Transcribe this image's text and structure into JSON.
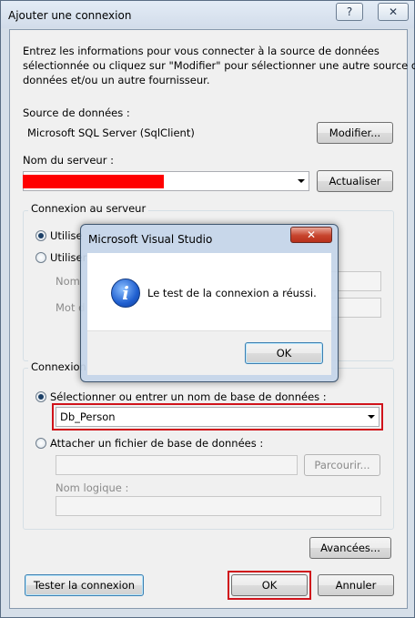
{
  "window": {
    "title": "Ajouter une connexion",
    "help_glyph": "?",
    "close_glyph": "✕"
  },
  "intro_text_lines": [
    "Entrez les informations pour vous connecter à la source de données",
    "sélectionnée ou cliquez sur \"Modifier\" pour sélectionner une autre source de",
    "données et/ou un autre fournisseur."
  ],
  "data_source": {
    "label": "Source de données :",
    "value": "Microsoft SQL Server (SqlClient)",
    "modify_button": "Modifier..."
  },
  "server": {
    "label": "Nom du serveur :",
    "value": "",
    "refresh_button": "Actualiser"
  },
  "server_connection": {
    "group_title": "Connexion au serveur",
    "option_windows": "Utilise",
    "option_sql": "Utiliser",
    "username_label": "Nom",
    "password_label": "Mot d"
  },
  "database_connection": {
    "group_title": "Connexion",
    "option_select": "Sélectionner ou entrer un nom de base de données :",
    "database_value": "Db_Person",
    "option_attach": "Attacher un fichier de base de données :",
    "browse_button": "Parcourir...",
    "logical_name_label": "Nom logique :"
  },
  "buttons": {
    "advanced": "Avancées...",
    "test": "Tester la connexion",
    "ok": "OK",
    "cancel": "Annuler"
  },
  "message_box": {
    "title": "Microsoft Visual Studio",
    "close_glyph": "✕",
    "icon_glyph": "i",
    "message": "Le test de la connexion a réussi.",
    "ok": "OK"
  },
  "colors": {
    "highlight_red": "#d0131b",
    "redaction_red": "#ff0000"
  }
}
